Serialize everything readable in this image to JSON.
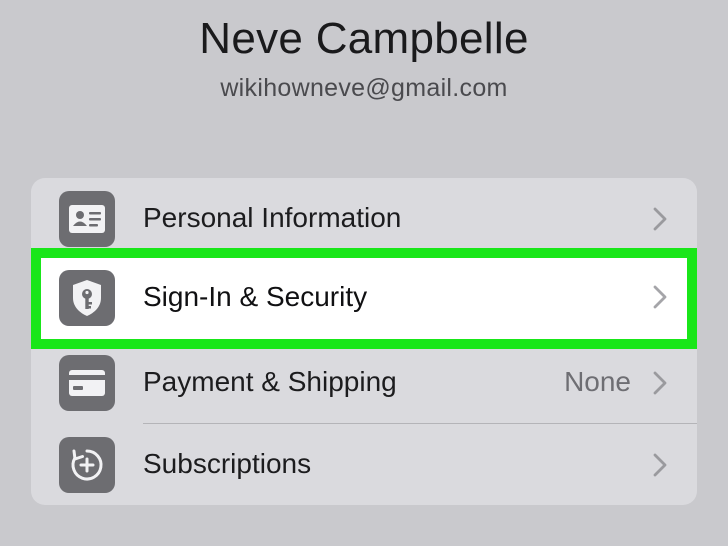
{
  "profile": {
    "name": "Neve Campbelle",
    "email": "wikihowneve@gmail.com"
  },
  "settings": {
    "items": [
      {
        "label": "Personal Information",
        "value": "",
        "icon": "id-card-icon"
      },
      {
        "label": "Sign-In & Security",
        "value": "",
        "icon": "shield-key-icon",
        "highlighted": true
      },
      {
        "label": "Payment & Shipping",
        "value": "None",
        "icon": "credit-card-icon"
      },
      {
        "label": "Subscriptions",
        "value": "",
        "icon": "subscriptions-icon"
      }
    ]
  },
  "colors": {
    "background": "#c9c9cd",
    "card": "#dadade",
    "icon_tile": "#6d6d71",
    "highlight_border": "#19e619"
  }
}
